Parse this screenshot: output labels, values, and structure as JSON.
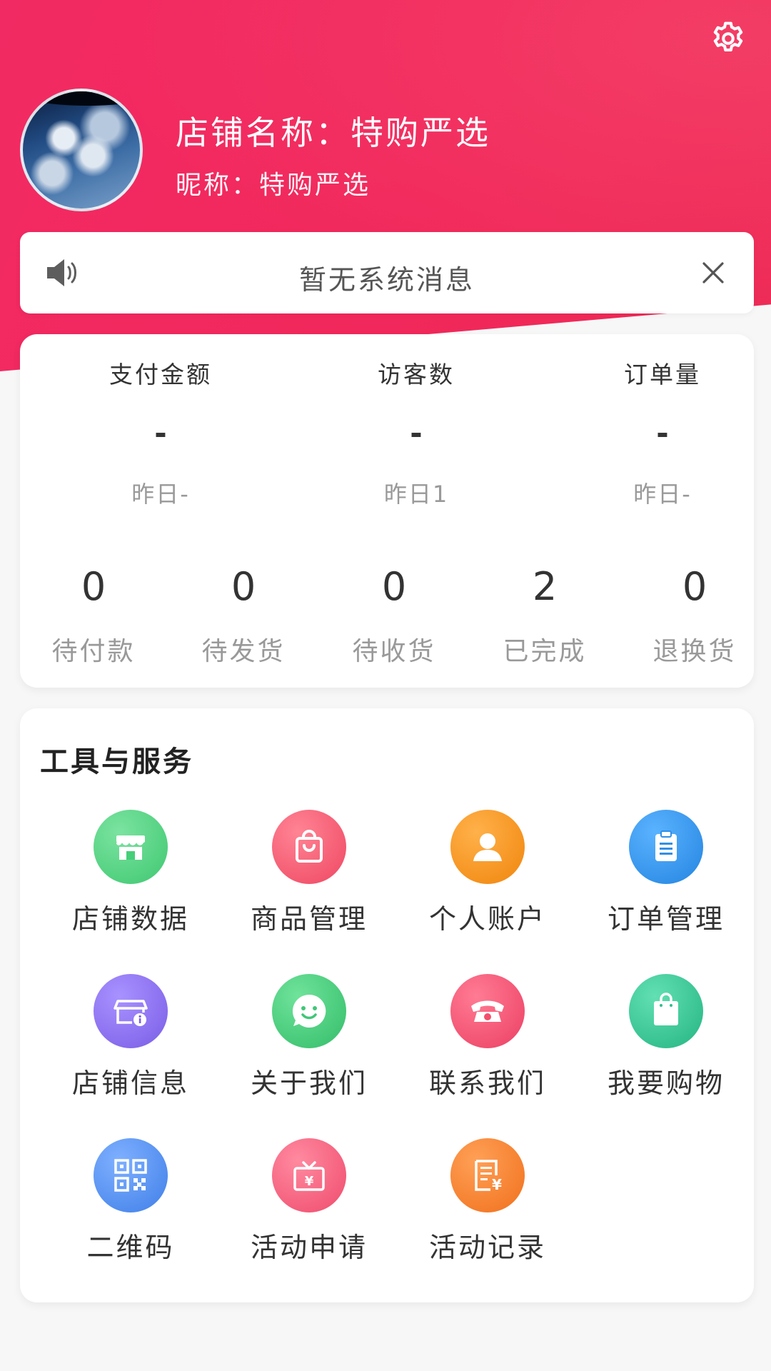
{
  "header": {
    "store_name": "店铺名称：特购严选",
    "nickname": "昵称：特购严选",
    "settings_icon": "gear-icon",
    "accent_color": "#f1285c"
  },
  "notice": {
    "message": "暂无系统消息",
    "speaker_icon": "speaker-icon",
    "close_icon": "close-icon"
  },
  "stats": [
    {
      "title": "支付金额",
      "value": "-",
      "yesterday": "昨日-"
    },
    {
      "title": "访客数",
      "value": "-",
      "yesterday": "昨日1"
    },
    {
      "title": "订单量",
      "value": "-",
      "yesterday": "昨日-"
    }
  ],
  "orders": [
    {
      "count": "0",
      "label": "待付款"
    },
    {
      "count": "0",
      "label": "待发货"
    },
    {
      "count": "0",
      "label": "待收货"
    },
    {
      "count": "2",
      "label": "已完成"
    },
    {
      "count": "0",
      "label": "退换货"
    }
  ],
  "tools": {
    "title": "工具与服务",
    "items": [
      {
        "label": "店铺数据",
        "icon": "store-icon",
        "color": "#45cf78"
      },
      {
        "label": "商品管理",
        "icon": "shopping-bag-icon",
        "color": "#f4556a"
      },
      {
        "label": "个人账户",
        "icon": "user-icon",
        "color": "#f58a12"
      },
      {
        "label": "订单管理",
        "icon": "clipboard-icon",
        "color": "#2f8fe8"
      },
      {
        "label": "店铺信息",
        "icon": "store-info-icon",
        "color": "#8a6cf0"
      },
      {
        "label": "关于我们",
        "icon": "smiley-icon",
        "color": "#3fc777"
      },
      {
        "label": "联系我们",
        "icon": "phone-icon",
        "color": "#f2506c"
      },
      {
        "label": "我要购物",
        "icon": "shopping-bag-icon",
        "color": "#2fbf8e"
      },
      {
        "label": "二维码",
        "icon": "qr-code-icon",
        "color": "#4f8ef0"
      },
      {
        "label": "活动申请",
        "icon": "gift-icon",
        "color": "#f45a78"
      },
      {
        "label": "活动记录",
        "icon": "receipt-icon",
        "color": "#f47a22"
      }
    ]
  }
}
